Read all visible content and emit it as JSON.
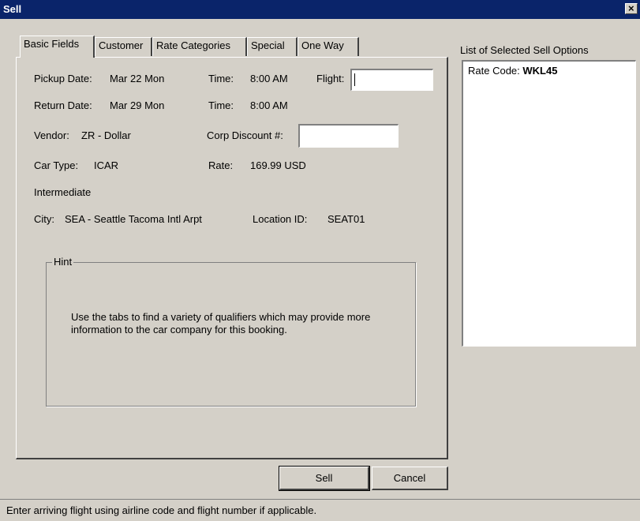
{
  "window": {
    "title": "Sell"
  },
  "tabs": [
    "Basic Fields",
    "Customer",
    "Rate Categories",
    "Special",
    "One Way"
  ],
  "fields": {
    "pickup_date_label": "Pickup Date:",
    "pickup_date": "Mar 22 Mon",
    "pickup_time_label": "Time:",
    "pickup_time": "8:00 AM",
    "flight_label": "Flight:",
    "flight_value": "",
    "return_date_label": "Return Date:",
    "return_date": "Mar 29 Mon",
    "return_time_label": "Time:",
    "return_time": "8:00 AM",
    "vendor_label": "Vendor:",
    "vendor": "ZR - Dollar",
    "corp_discount_label": "Corp Discount #:",
    "corp_discount_value": "",
    "car_type_label": "Car Type:",
    "car_type": "ICAR",
    "rate_label": "Rate:",
    "rate": "169.99 USD",
    "car_class": "Intermediate",
    "city_label": "City:",
    "city": "SEA - Seattle Tacoma Intl Arpt",
    "location_label": "Location ID:",
    "location_id": "SEAT01"
  },
  "hint": {
    "label": "Hint",
    "text": "Use the tabs to find a variety of qualifiers which may provide more information to the car company for this booking."
  },
  "selected_options": {
    "label": "List of Selected Sell Options",
    "item_label": "Rate Code:",
    "item_value": "WKL45"
  },
  "buttons": {
    "sell": "Sell",
    "cancel": "Cancel"
  },
  "status": "Enter arriving flight using airline code and flight number if applicable."
}
